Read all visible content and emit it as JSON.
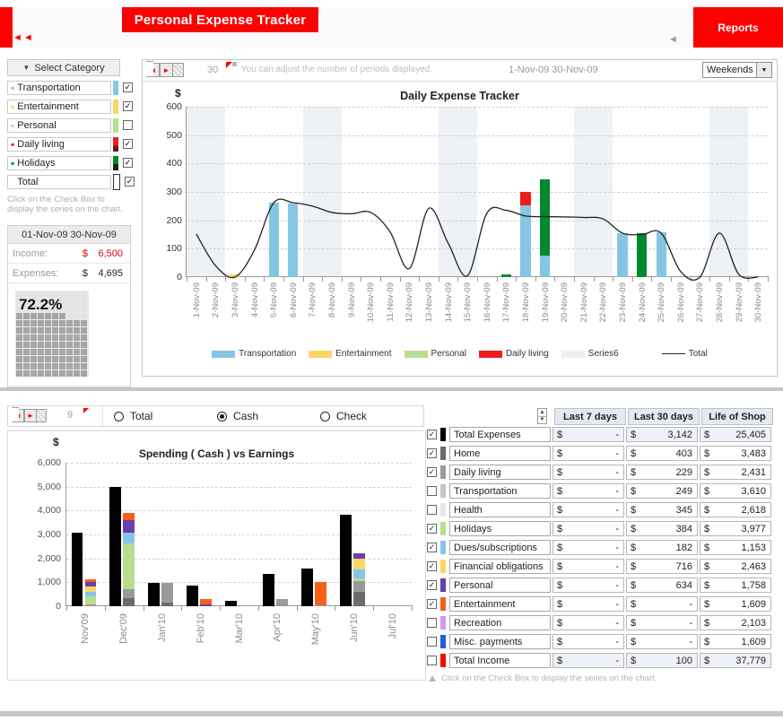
{
  "banner": {
    "title": "Personal Expense Tracker",
    "reports_label": "Reports",
    "nav_back_icon": "double-left-arrow-icon",
    "collapse_icon": "left-triangle-icon"
  },
  "sidebar": {
    "select_category_label": "Select Category",
    "categories": [
      {
        "label": "Transportation",
        "color": "#86c5e3",
        "checked": true
      },
      {
        "label": "Entertainment",
        "color": "#f8d766",
        "checked": true
      },
      {
        "label": "Personal",
        "color": "#b9dd8e",
        "checked": false
      },
      {
        "label": "Daily living",
        "color": "#ee1c1c",
        "checked": true
      },
      {
        "label": "Holidays",
        "color": "#00892f",
        "checked": true
      },
      {
        "label": "Total",
        "color": "#ffffff",
        "checked": true
      }
    ],
    "hint": "Click on the Check Box to display the series on the chart.",
    "summary": {
      "date_range": "01-Nov-09  30-Nov-09",
      "income_label": "Income:",
      "income_currency": "$",
      "income_value": "6,500",
      "expenses_label": "Expenses:",
      "expenses_currency": "$",
      "expenses_value": "4,695",
      "gauge_percent": "72.2%",
      "gauge_value": 72.2
    }
  },
  "top_panel": {
    "periods_value": "30",
    "note": "You can adjust the number of periods displayed.",
    "date_range": "1-Nov-09  30-Nov-09",
    "select_value": "Weekends",
    "prev_icon": "left-arrow-icon",
    "next_icon": "right-arrow-icon",
    "dropdown_icon": "chevron-down-icon"
  },
  "chart_data": [
    {
      "type": "bar",
      "id": "daily-expense-tracker",
      "title": "Daily Expense Tracker",
      "ylabel": "$",
      "xlabel": "",
      "ylim": [
        0,
        600
      ],
      "yticks": [
        0,
        100,
        200,
        300,
        400,
        500,
        600
      ],
      "grid": true,
      "legend_position": "bottom",
      "categories": [
        "1-Nov-09",
        "2-Nov-09",
        "3-Nov-09",
        "4-Nov-09",
        "5-Nov-09",
        "6-Nov-09",
        "7-Nov-09",
        "8-Nov-09",
        "9-Nov-09",
        "10-Nov-09",
        "11-Nov-09",
        "12-Nov-09",
        "13-Nov-09",
        "14-Nov-09",
        "15-Nov-09",
        "16-Nov-09",
        "17-Nov-09",
        "18-Nov-09",
        "19-Nov-09",
        "20-Nov-09",
        "21-Nov-09",
        "22-Nov-09",
        "23-Nov-09",
        "24-Nov-09",
        "25-Nov-09",
        "26-Nov-09",
        "27-Nov-09",
        "28-Nov-09",
        "29-Nov-09",
        "30-Nov-09"
      ],
      "weekend_bands": [
        [
          0,
          1
        ],
        [
          6,
          7
        ],
        [
          13,
          14
        ],
        [
          20,
          21
        ],
        [
          27,
          28
        ]
      ],
      "series": [
        {
          "name": "Transportation",
          "color": "#86c5e3",
          "values": [
            0,
            0,
            0,
            0,
            262,
            260,
            0,
            0,
            0,
            0,
            0,
            0,
            0,
            0,
            0,
            0,
            0,
            252,
            75,
            0,
            0,
            0,
            155,
            0,
            157,
            0,
            0,
            0,
            0,
            0
          ]
        },
        {
          "name": "Entertainment",
          "color": "#f8d766",
          "values": [
            0,
            0,
            8,
            0,
            0,
            0,
            0,
            0,
            0,
            0,
            0,
            0,
            0,
            0,
            0,
            0,
            0,
            0,
            0,
            0,
            0,
            0,
            0,
            0,
            0,
            0,
            0,
            0,
            0,
            0
          ]
        },
        {
          "name": "Personal",
          "color": "#b9dd8e",
          "values": [
            0,
            0,
            0,
            0,
            0,
            0,
            0,
            0,
            0,
            0,
            0,
            0,
            0,
            0,
            0,
            0,
            0,
            0,
            0,
            0,
            0,
            0,
            0,
            0,
            0,
            0,
            0,
            0,
            0,
            0
          ]
        },
        {
          "name": "Daily living",
          "color": "#ee1c1c",
          "values": [
            0,
            0,
            0,
            0,
            0,
            0,
            0,
            0,
            0,
            0,
            0,
            0,
            0,
            0,
            0,
            0,
            0,
            48,
            0,
            0,
            0,
            0,
            0,
            0,
            0,
            0,
            0,
            0,
            0,
            0
          ]
        },
        {
          "name": "Series6",
          "color": "#f0f0f0",
          "values": [
            0,
            0,
            0,
            0,
            0,
            0,
            0,
            0,
            0,
            0,
            0,
            0,
            0,
            0,
            0,
            0,
            0,
            0,
            0,
            0,
            0,
            0,
            0,
            0,
            0,
            0,
            0,
            0,
            0,
            0
          ]
        },
        {
          "name": "Holidays",
          "color": "#00892f",
          "values": [
            0,
            0,
            0,
            0,
            0,
            0,
            0,
            0,
            0,
            0,
            0,
            0,
            0,
            0,
            0,
            0,
            8,
            0,
            270,
            0,
            0,
            0,
            0,
            155,
            0,
            0,
            0,
            0,
            0,
            0
          ]
        }
      ],
      "line_series": {
        "name": "Total",
        "color": "#222222",
        "values": [
          152,
          40,
          0,
          95,
          262,
          262,
          250,
          228,
          223,
          228,
          160,
          30,
          242,
          120,
          5,
          225,
          235,
          215,
          213,
          212,
          210,
          205,
          155,
          150,
          155,
          20,
          0,
          155,
          10,
          0
        ]
      }
    },
    {
      "type": "bar",
      "id": "spending-vs-earnings",
      "title": "Spending  ( Cash ) vs Earnings",
      "ylabel": "$",
      "ylim": [
        0,
        6000
      ],
      "yticks": [
        0,
        1000,
        2000,
        3000,
        4000,
        5000,
        6000
      ],
      "ytick_labels": [
        "0",
        "1,000",
        "2,000",
        "3,000",
        "4,000",
        "5,000",
        "6,000"
      ],
      "grid": true,
      "categories": [
        "Nov'09",
        "Dec'09",
        "Jan'10",
        "Feb'10",
        "Mar'10",
        "Apr'10",
        "May'10",
        "Jun'10",
        "Jul'10"
      ],
      "series": [
        {
          "name": "Total Income",
          "color": "#000000",
          "type": "bar",
          "values": [
            3090,
            4970,
            970,
            880,
            230,
            1340,
            1580,
            3840,
            0
          ]
        },
        {
          "name": "Home",
          "color": "#6b6b6b",
          "type": "stack",
          "values": [
            0,
            320,
            140,
            0,
            0,
            0,
            0,
            600,
            0
          ]
        },
        {
          "name": "Daily living",
          "color": "#9a9a9a",
          "type": "stack",
          "values": [
            60,
            390,
            830,
            0,
            0,
            290,
            40,
            440,
            0
          ]
        },
        {
          "name": "Holidays",
          "color": "#b9dd8e",
          "type": "stack",
          "values": [
            340,
            1910,
            0,
            0,
            0,
            0,
            0,
            130,
            0
          ]
        },
        {
          "name": "Dues/subscriptions",
          "color": "#86c5e3",
          "type": "stack",
          "values": [
            200,
            450,
            0,
            0,
            0,
            0,
            0,
            380,
            0
          ]
        },
        {
          "name": "Financial obligations",
          "color": "#f8d766",
          "type": "stack",
          "values": [
            220,
            0,
            0,
            0,
            0,
            0,
            0,
            450,
            0
          ]
        },
        {
          "name": "Personal",
          "color": "#6a3eac",
          "type": "stack",
          "values": [
            200,
            530,
            0,
            70,
            0,
            0,
            0,
            230,
            0
          ]
        },
        {
          "name": "Entertainment",
          "color": "#f4601a",
          "type": "stack",
          "values": [
            90,
            300,
            0,
            240,
            0,
            0,
            980,
            0,
            0
          ]
        }
      ]
    }
  ],
  "bottom_controls": {
    "periods_value": "9",
    "radios": [
      {
        "label": "Total",
        "selected": false
      },
      {
        "label": "Cash",
        "selected": true
      },
      {
        "label": "Check",
        "selected": false
      }
    ]
  },
  "table": {
    "headers": [
      "Last 7 days",
      "Last 30 days",
      "Life of Shop"
    ],
    "currency": "$",
    "rows": [
      {
        "label": "Total Expenses",
        "color": "#000000",
        "checked": true,
        "highlight": true,
        "last7": "-",
        "last30": "3,142",
        "life": "25,405"
      },
      {
        "label": "Home",
        "color": "#6b6b6b",
        "checked": true,
        "highlight": false,
        "last7": "-",
        "last30": "403",
        "life": "3,483"
      },
      {
        "label": "Daily living",
        "color": "#9a9a9a",
        "checked": true,
        "highlight": false,
        "last7": "-",
        "last30": "229",
        "life": "2,431"
      },
      {
        "label": "Transportation",
        "color": "#c9c5bd",
        "checked": false,
        "highlight": false,
        "last7": "-",
        "last30": "249",
        "life": "3,610"
      },
      {
        "label": "Health",
        "color": "#e8e8e8",
        "checked": false,
        "highlight": false,
        "last7": "-",
        "last30": "345",
        "life": "2,618"
      },
      {
        "label": "Holidays",
        "color": "#b9dd8e",
        "checked": true,
        "highlight": false,
        "last7": "-",
        "last30": "384",
        "life": "3,977"
      },
      {
        "label": "Dues/subscriptions",
        "color": "#86c5e3",
        "checked": true,
        "highlight": false,
        "last7": "-",
        "last30": "182",
        "life": "1,153"
      },
      {
        "label": "Financial obligations",
        "color": "#f8d766",
        "checked": true,
        "highlight": false,
        "last7": "-",
        "last30": "716",
        "life": "2,463"
      },
      {
        "label": "Personal",
        "color": "#6a3eac",
        "checked": true,
        "highlight": false,
        "last7": "-",
        "last30": "634",
        "life": "1,758"
      },
      {
        "label": "Entertainment",
        "color": "#f4601a",
        "checked": true,
        "highlight": false,
        "last7": "-",
        "last30": "-",
        "life": "1,609"
      },
      {
        "label": "Recreation",
        "color": "#cf9bf0",
        "checked": false,
        "highlight": false,
        "last7": "-",
        "last30": "-",
        "life": "2,103"
      },
      {
        "label": "Misc. payments",
        "color": "#1f5cf0",
        "checked": false,
        "highlight": false,
        "last7": "-",
        "last30": "-",
        "life": "1,609"
      },
      {
        "label": "Total Income",
        "color": "#fd0000",
        "checked": false,
        "highlight": true,
        "last7": "-",
        "last30": "100",
        "life": "37,779"
      }
    ],
    "note": "Click on the Check Box to display the series on the chart."
  }
}
